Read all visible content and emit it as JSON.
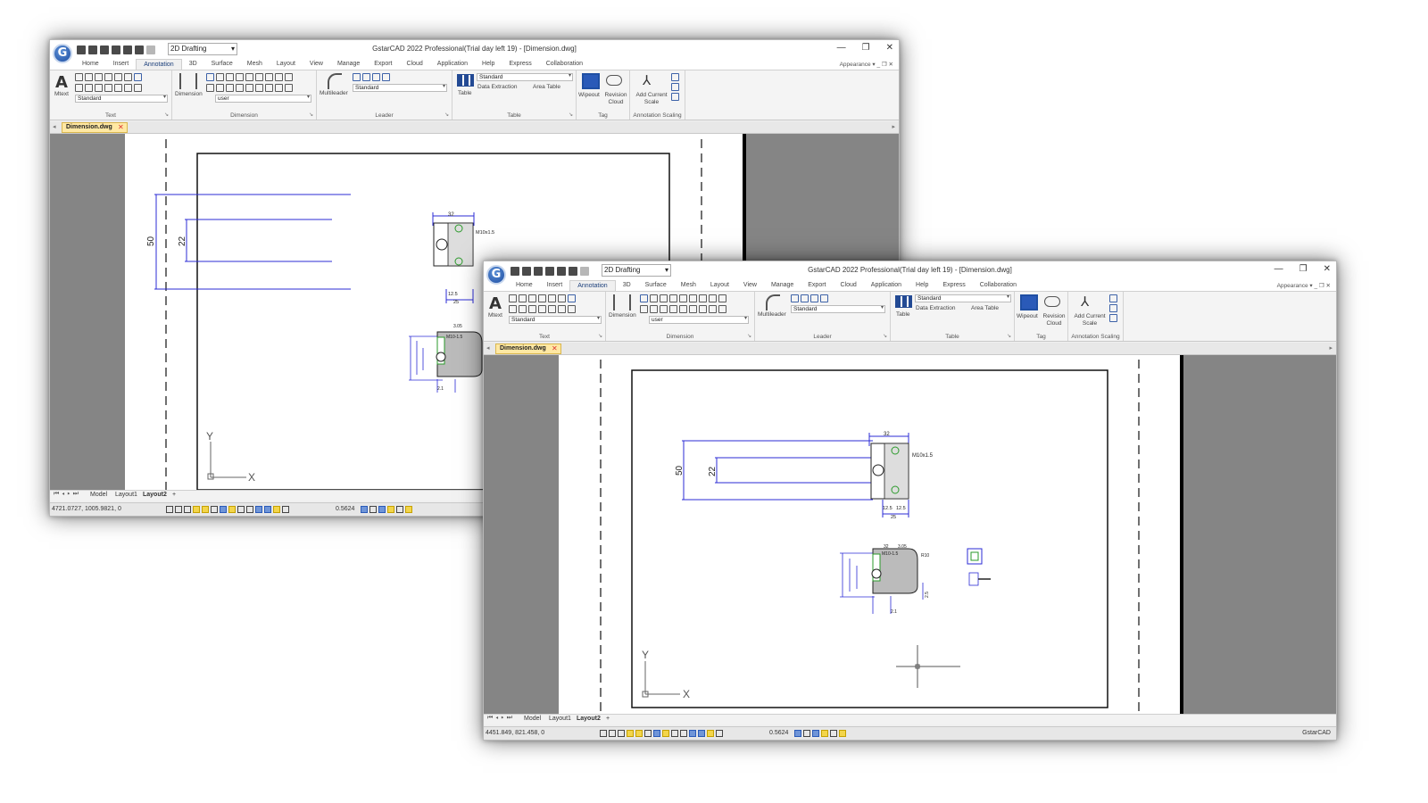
{
  "app": {
    "title": "GstarCAD 2022 Professional(Trial day left 19) - [Dimension.dwg]",
    "logo_letter": "G",
    "workspace": "2D Drafting",
    "window_controls": [
      "—",
      "❐",
      "✕"
    ]
  },
  "menu": {
    "tabs": [
      "Home",
      "Insert",
      "Annotation",
      "3D",
      "Surface",
      "Mesh",
      "Layout",
      "View",
      "Manage",
      "Export",
      "Cloud",
      "Application",
      "Help",
      "Express",
      "Collaboration"
    ],
    "active": "Annotation",
    "appearance": "Appearance ▾  _  ❐  ✕"
  },
  "ribbon": {
    "mtext": "Mtext",
    "text_style": "Standard",
    "dimension": "Dimension",
    "dim_style": "user",
    "multileader": "Multileader",
    "leader_style": "Standard",
    "table": "Table",
    "table_style": "Standard",
    "data_extraction": "Data Extraction",
    "area_table": "Area Table",
    "wipeout": "Wipeout",
    "revision_cloud": "Revision Cloud",
    "add_current_scale": "Add Current Scale",
    "panels": {
      "text": "Text",
      "dimension": "Dimension",
      "leader": "Leader",
      "table": "Table",
      "tag": "Tag",
      "annotation_scaling": "Annotation Scaling"
    }
  },
  "document_tab": "Dimension.dwg",
  "layout_tabs": [
    "Model",
    "Layout1",
    "Layout2"
  ],
  "active_layout": "Layout2",
  "drawing": {
    "dim_50": "50",
    "dim_22": "22",
    "dim_32": "32",
    "thread": "M10x1.5",
    "dim_12_5a": "12.5",
    "dim_12_5b": "12.5",
    "dim_25": "25",
    "dim_3_05": "3.05",
    "thread2": "M10-1.5",
    "dim_R10": "R10",
    "dim_2_5": "2.5",
    "dim_2_1": "2.1",
    "axis_x": "X",
    "axis_y": "Y"
  },
  "window1": {
    "coords": "4721.0727, 1005.9821, 0",
    "scale": "0.5624"
  },
  "window2": {
    "coords": "4451.849, 821.458, 0",
    "scale": "0.5624",
    "right_status": "GstarCAD"
  },
  "colors": {
    "dimension_blue": "#2b2bd6",
    "active_tab": "#ffe8a3",
    "canvas_gray": "#858585"
  }
}
